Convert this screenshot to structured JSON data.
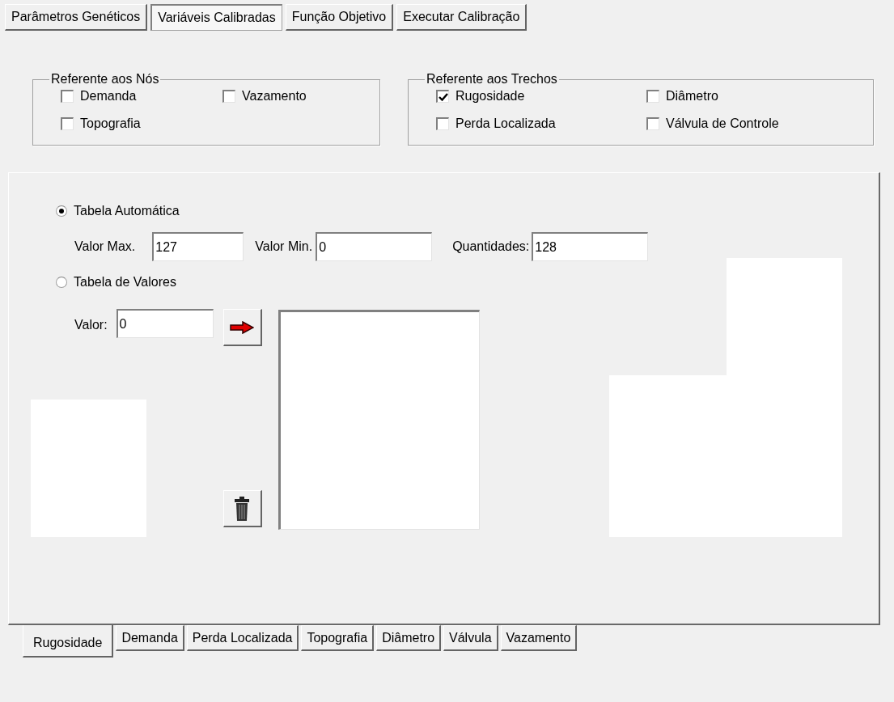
{
  "top_tabs": [
    {
      "label": "Parâmetros Genéticos",
      "selected": false
    },
    {
      "label": "Variáveis Calibradas",
      "selected": true
    },
    {
      "label": "Função Objetivo",
      "selected": false
    },
    {
      "label": "Executar Calibração",
      "selected": false
    }
  ],
  "groups": [
    {
      "title": "Referente aos Nós",
      "options": [
        {
          "label": "Demanda",
          "checked": false
        },
        {
          "label": "Vazamento",
          "checked": false
        },
        {
          "label": "Topografia",
          "checked": false
        }
      ]
    },
    {
      "title": "Referente aos Trechos",
      "options": [
        {
          "label": "Rugosidade",
          "checked": true
        },
        {
          "label": "Diâmetro",
          "checked": false
        },
        {
          "label": "Perda Localizada",
          "checked": false
        },
        {
          "label": "Válvula de Controle",
          "checked": false
        }
      ]
    }
  ],
  "table_mode": [
    {
      "label": "Tabela Automática",
      "selected": true
    },
    {
      "label": "Tabela de Valores",
      "selected": false
    }
  ],
  "auto_fields": [
    {
      "label": "Valor Max.",
      "value": "127"
    },
    {
      "label": "Valor Min.",
      "value": "0"
    },
    {
      "label": "Quantidades:",
      "value": "128"
    }
  ],
  "value_field": {
    "label": "Valor:",
    "value": "0"
  },
  "bottom_tabs": [
    {
      "label": "Rugosidade",
      "selected": true
    },
    {
      "label": "Demanda",
      "selected": false
    },
    {
      "label": "Perda Localizada",
      "selected": false
    },
    {
      "label": "Topografia",
      "selected": false
    },
    {
      "label": "Diâmetro",
      "selected": false
    },
    {
      "label": "Válvula",
      "selected": false
    },
    {
      "label": "Vazamento",
      "selected": false
    }
  ]
}
